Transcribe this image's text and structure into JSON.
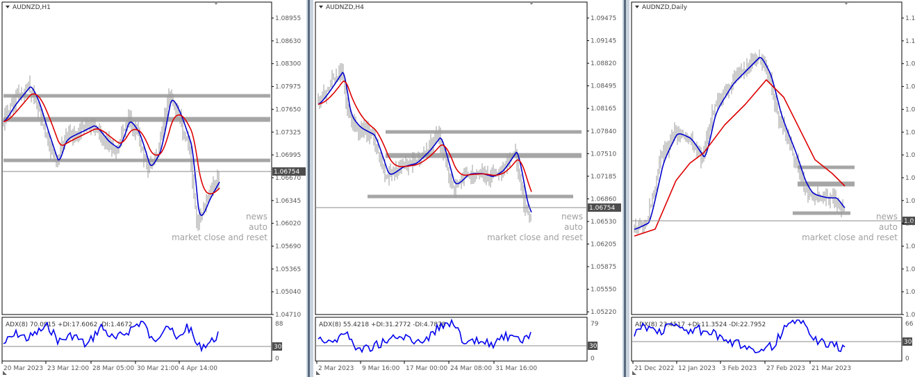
{
  "charts": [
    {
      "id": "h1",
      "symbol_label": "AUDNZD,H1",
      "price_labels": [
        "1.08955",
        "1.08630",
        "1.08300",
        "1.07975",
        "1.07650",
        "1.07325",
        "1.06995",
        "1.06670",
        "1.06345",
        "1.06020",
        "1.05690",
        "1.05365",
        "1.05040",
        "1.04710"
      ],
      "current_price": "1.06754",
      "overlay_lines": [
        "news",
        "auto",
        "market close and reset"
      ],
      "indicator_label": "ADX(8) 70.0915 +DI:17.6062 -DI:1.4672",
      "indicator_scale": [
        "88",
        "30",
        "0"
      ],
      "time_labels": [
        "20 Mar 2023",
        "23 Mar 12:00",
        "28 Mar 05:00",
        "30 Mar 21:00",
        "4 Apr 14:00"
      ]
    },
    {
      "id": "h4",
      "symbol_label": "AUDNZD,H4",
      "price_labels": [
        "1.09475",
        "1.09145",
        "1.08820",
        "1.08495",
        "1.08165",
        "1.07840",
        "1.07510",
        "1.07185",
        "1.06860",
        "1.06530",
        "1.06205",
        "1.05875",
        "1.05550",
        "1.05220"
      ],
      "current_price": "1.06754",
      "overlay_lines": [
        "news",
        "auto",
        "market close and reset"
      ],
      "indicator_label": "ADX(8) 55.4218 +DI:31.2772 -DI:4.7878",
      "indicator_scale": [
        "79",
        "30",
        "0"
      ],
      "time_labels": [
        "2 Mar 2023",
        "9 Mar 16:00",
        "17 Mar 00:00",
        "24 Mar 08:00",
        "31 Mar 16:00"
      ]
    },
    {
      "id": "d1",
      "symbol_label": "AUDNZD,Daily",
      "price_labels": [
        "1.1",
        "1.1",
        "1.0",
        "1.0",
        "1.0",
        "1.0",
        "1.0",
        "1.0",
        "1.0",
        "1.0",
        "1.0",
        "1.0",
        "1.0",
        "1.0"
      ],
      "current_price": "1.0",
      "overlay_lines": [
        "news",
        "auto",
        "market close and reset"
      ],
      "indicator_label": "ADX(8) 23.4517 +DI:11.3524 -DI:22.7952",
      "indicator_scale": [
        "66",
        "30",
        "0"
      ],
      "time_labels": [
        "21 Dec 2022",
        "12 Jan 2023",
        "3 Feb 2023",
        "27 Feb 2023",
        "21 Mar 2023"
      ]
    }
  ],
  "colors": {
    "bars": "#9b9b9b",
    "fast_ma": "#0000cc",
    "slow_ma": "#dd0000",
    "levels": "#a6a6a6",
    "adx": "#0000ee",
    "text": "#555555",
    "overlay_text": "#a0a0a0"
  }
}
